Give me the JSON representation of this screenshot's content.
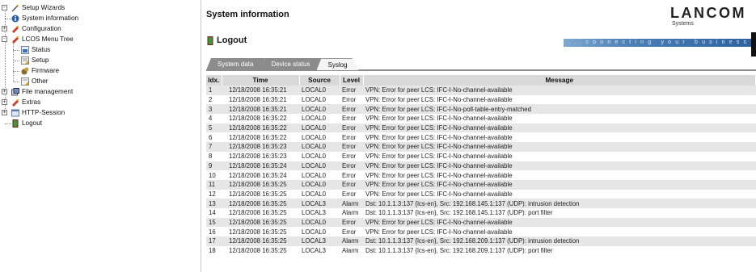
{
  "tree": {
    "items": [
      {
        "label": "Setup Wizards"
      },
      {
        "label": "System information"
      },
      {
        "label": "Configuration"
      },
      {
        "label": "LCOS Menu Tree"
      },
      {
        "label": "Status"
      },
      {
        "label": "Setup"
      },
      {
        "label": "Firmware"
      },
      {
        "label": "Other"
      },
      {
        "label": "File management"
      },
      {
        "label": "Extras"
      },
      {
        "label": "HTTP-Session"
      },
      {
        "label": "Logout"
      }
    ]
  },
  "header": {
    "title": "System information",
    "brand": "LANCOM",
    "brand_sub": "Systems",
    "tagline": "...connecting your business"
  },
  "section": {
    "logout_label": "Logout"
  },
  "tabs": [
    {
      "label": "System data"
    },
    {
      "label": "Device status"
    },
    {
      "label": "Syslog"
    }
  ],
  "table": {
    "headers": [
      "Idx.",
      "Time",
      "Source",
      "Level",
      "Message"
    ],
    "rows": [
      [
        "1",
        "12/18/2008 16:35:21",
        "LOCAL0",
        "Error",
        "VPN: Error for peer LCS: IFC-I-No-channel-available"
      ],
      [
        "2",
        "12/18/2008 16:35:21",
        "LOCAL0",
        "Error",
        "VPN: Error for peer LCS: IFC-I-No-channel-available"
      ],
      [
        "3",
        "12/18/2008 16:35:21",
        "LOCAL0",
        "Error",
        "VPN: Error for peer LCS: IFC-I-No-poll-table-entry-matched"
      ],
      [
        "4",
        "12/18/2008 16:35:22",
        "LOCAL0",
        "Error",
        "VPN: Error for peer LCS: IFC-I-No-channel-available"
      ],
      [
        "5",
        "12/18/2008 16:35:22",
        "LOCAL0",
        "Error",
        "VPN: Error for peer LCS: IFC-I-No-channel-available"
      ],
      [
        "6",
        "12/18/2008 16:35:22",
        "LOCAL0",
        "Error",
        "VPN: Error for peer LCS: IFC-I-No-channel-available"
      ],
      [
        "7",
        "12/18/2008 16:35:23",
        "LOCAL0",
        "Error",
        "VPN: Error for peer LCS: IFC-I-No-channel-available"
      ],
      [
        "8",
        "12/18/2008 16:35:23",
        "LOCAL0",
        "Error",
        "VPN: Error for peer LCS: IFC-I-No-channel-available"
      ],
      [
        "9",
        "12/18/2008 16:35:24",
        "LOCAL0",
        "Error",
        "VPN: Error for peer LCS: IFC-I-No-channel-available"
      ],
      [
        "10",
        "12/18/2008 16:35:24",
        "LOCAL0",
        "Error",
        "VPN: Error for peer LCS: IFC-I-No-channel-available"
      ],
      [
        "11",
        "12/18/2008 16:35:25",
        "LOCAL0",
        "Error",
        "VPN: Error for peer LCS: IFC-I-No-channel-available"
      ],
      [
        "12",
        "12/18/2008 16:35:25",
        "LOCAL0",
        "Error",
        "VPN: Error for peer LCS: IFC-I-No-channel-available"
      ],
      [
        "13",
        "12/18/2008 16:35:25",
        "LOCAL3",
        "Alarm",
        "Dst: 10.1.1.3:137 {lcs-en}, Src: 192.168.145.1:137 (UDP): intrusion detection"
      ],
      [
        "14",
        "12/18/2008 16:35:25",
        "LOCAL3",
        "Alarm",
        "Dst: 10.1.1.3:137 {lcs-en}, Src: 192.168.145.1:137 (UDP): port filter"
      ],
      [
        "15",
        "12/18/2008 16:35:25",
        "LOCAL0",
        "Error",
        "VPN: Error for peer LCS: IFC-I-No-channel-available"
      ],
      [
        "16",
        "12/18/2008 16:35:25",
        "LOCAL0",
        "Error",
        "VPN: Error for peer LCS: IFC-I-No-channel-available"
      ],
      [
        "17",
        "12/18/2008 16:35:25",
        "LOCAL3",
        "Alarm",
        "Dst: 10.1.1.3:137 {lcs-en}, Src: 192.168.209.1:137 (UDP): intrusion detection"
      ],
      [
        "18",
        "12/18/2008 16:35:25",
        "LOCAL3",
        "Alarm",
        "Dst: 10.1.1.3:137 {lcs-en}, Src: 192.168.209.1:137 (UDP): port filter"
      ]
    ]
  },
  "colors": {
    "row_alt": "#e6e6e6",
    "header_bg": "#d9d9d9",
    "tab_bg": "#8c8c8c",
    "tagline_blue": "#2d62a0"
  }
}
